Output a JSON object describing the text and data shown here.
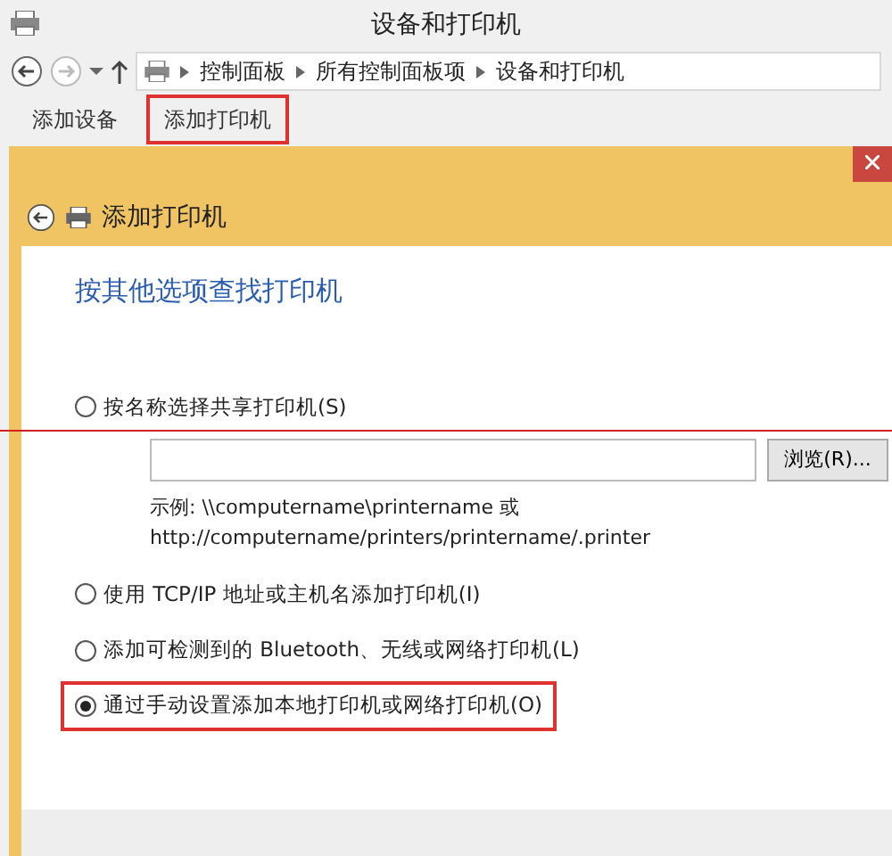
{
  "window": {
    "title": "设备和打印机"
  },
  "address_bar": {
    "path": [
      "控制面板",
      "所有控制面板项",
      "设备和打印机"
    ]
  },
  "toolbar": [
    {
      "label": "添加设备",
      "highlighted": false
    },
    {
      "label": "添加打印机",
      "highlighted": true
    }
  ],
  "dialog": {
    "title": "添加打印机",
    "heading": "按其他选项查找打印机",
    "options": [
      {
        "kind": "with-field",
        "label": "按名称选择共享打印机(S)",
        "selected": false,
        "highlighted": false
      },
      {
        "kind": "plain",
        "label": "使用 TCP/IP 地址或主机名添加打印机(I)",
        "selected": false,
        "highlighted": false
      },
      {
        "kind": "plain",
        "label": "添加可检测到的 Bluetooth、无线或网络打印机(L)",
        "selected": false,
        "highlighted": false
      },
      {
        "kind": "plain",
        "label": "通过手动设置添加本地打印机或网络打印机(O)",
        "selected": true,
        "highlighted": true
      }
    ],
    "browse_button": "浏览(R)...",
    "example_lines": [
      "示例: \\\\computername\\printername 或",
      "http://computername/printers/printername/.printer"
    ]
  },
  "annotation_line": true
}
